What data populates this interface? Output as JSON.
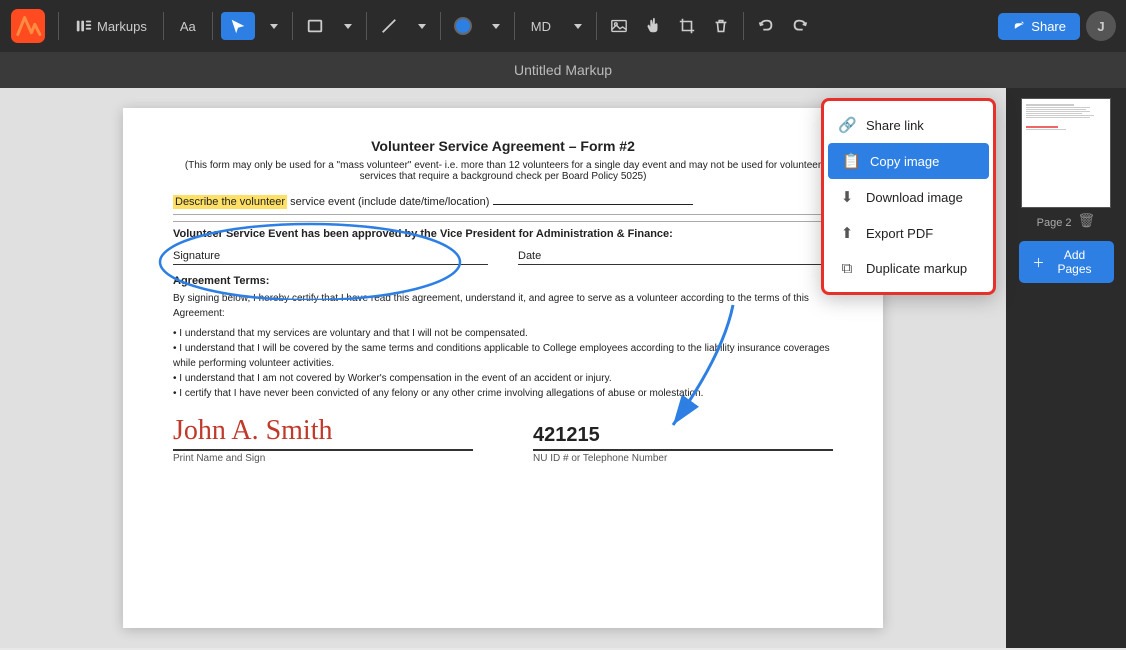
{
  "app": {
    "logo_text": "M",
    "title": "Untitled Markup"
  },
  "toolbar": {
    "markups_label": "Markups",
    "font_label": "Aa",
    "mode_label": "MD",
    "share_label": "Share",
    "avatar_label": "J"
  },
  "dropdown": {
    "items": [
      {
        "id": "share-link",
        "label": "Share link",
        "icon": "🔗"
      },
      {
        "id": "copy-image",
        "label": "Copy image",
        "icon": "📋"
      },
      {
        "id": "download-image",
        "label": "Download image",
        "icon": "⬇"
      },
      {
        "id": "export-pdf",
        "label": "Export PDF",
        "icon": "⬆"
      },
      {
        "id": "duplicate-markup",
        "label": "Duplicate markup",
        "icon": "⧉"
      }
    ]
  },
  "document": {
    "title": "Volunteer Service Agreement – Form #2",
    "subtitle": "(This form may only be used for a \"mass volunteer\" event- i.e. more than 12 volunteers for a single day event and may not be used for volunteer services that require a background check per Board Policy 5025)",
    "field_label": "Describe the volunteer",
    "field_rest": " service event (include date/time/location)",
    "approved_text": "Volunteer Service Event has been approved by the Vice President for Administration & Finance:",
    "signature_label": "Signature",
    "date_label": "Date",
    "agreement_title": "Agreement Terms:",
    "agreement_intro": "By signing below, I hereby certify that I have read this agreement, understand it, and agree to serve as a volunteer according to the terms of this Agreement:",
    "term1": "• I understand that my services are voluntary and that I will not be compensated.",
    "term2": "• I understand that I will be covered by the same terms and conditions applicable to College employees according to the liability insurance coverages while performing volunteer activities.",
    "term3": "• I understand that I am not covered by Worker's compensation in the event of an accident or injury.",
    "term4": "• I certify that I have never been convicted of any felony or any other crime involving allegations of abuse or molestation.",
    "sig_name": "John A. Smith",
    "sig_id": "421215",
    "print_label": "Print Name and Sign",
    "id_label": "NU ID # or Telephone Number"
  },
  "sidebar": {
    "page_label": "Page 2",
    "add_pages_label": "Add Pages"
  },
  "colors": {
    "blue": "#2d7fe3",
    "red_border": "#e8302b",
    "highlight_yellow": "#ffe066"
  }
}
